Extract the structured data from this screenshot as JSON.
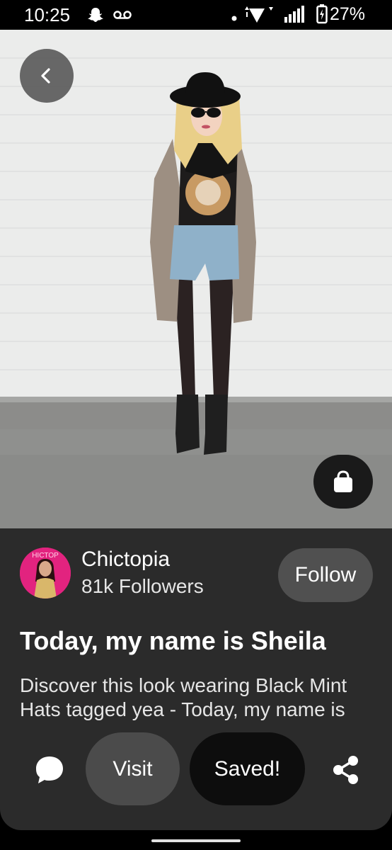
{
  "status_bar": {
    "time": "10:25",
    "battery_percent": "27%",
    "icons": [
      "snapchat-icon",
      "voicemail-icon",
      "dot-icon",
      "wifi-icon",
      "signal-icon",
      "battery-icon"
    ]
  },
  "pin": {
    "creator": {
      "name": "Chictopia",
      "followers": "81k Followers",
      "follow_label": "Follow",
      "avatar_text": "HICTOP"
    },
    "title": "Today, my name is Sheila",
    "description": "Discover this look wearing Black Mint Hats tagged yea - Today, my name is Sheila"
  },
  "actions": {
    "visit_label": "Visit",
    "saved_label": "Saved!",
    "icons": [
      "comment-icon",
      "share-icon"
    ]
  },
  "colors": {
    "panel_bg": "#2b2b2b",
    "follow_bg": "#505050",
    "visit_bg": "#4b4b4b",
    "saved_bg": "#0d0d0d"
  }
}
